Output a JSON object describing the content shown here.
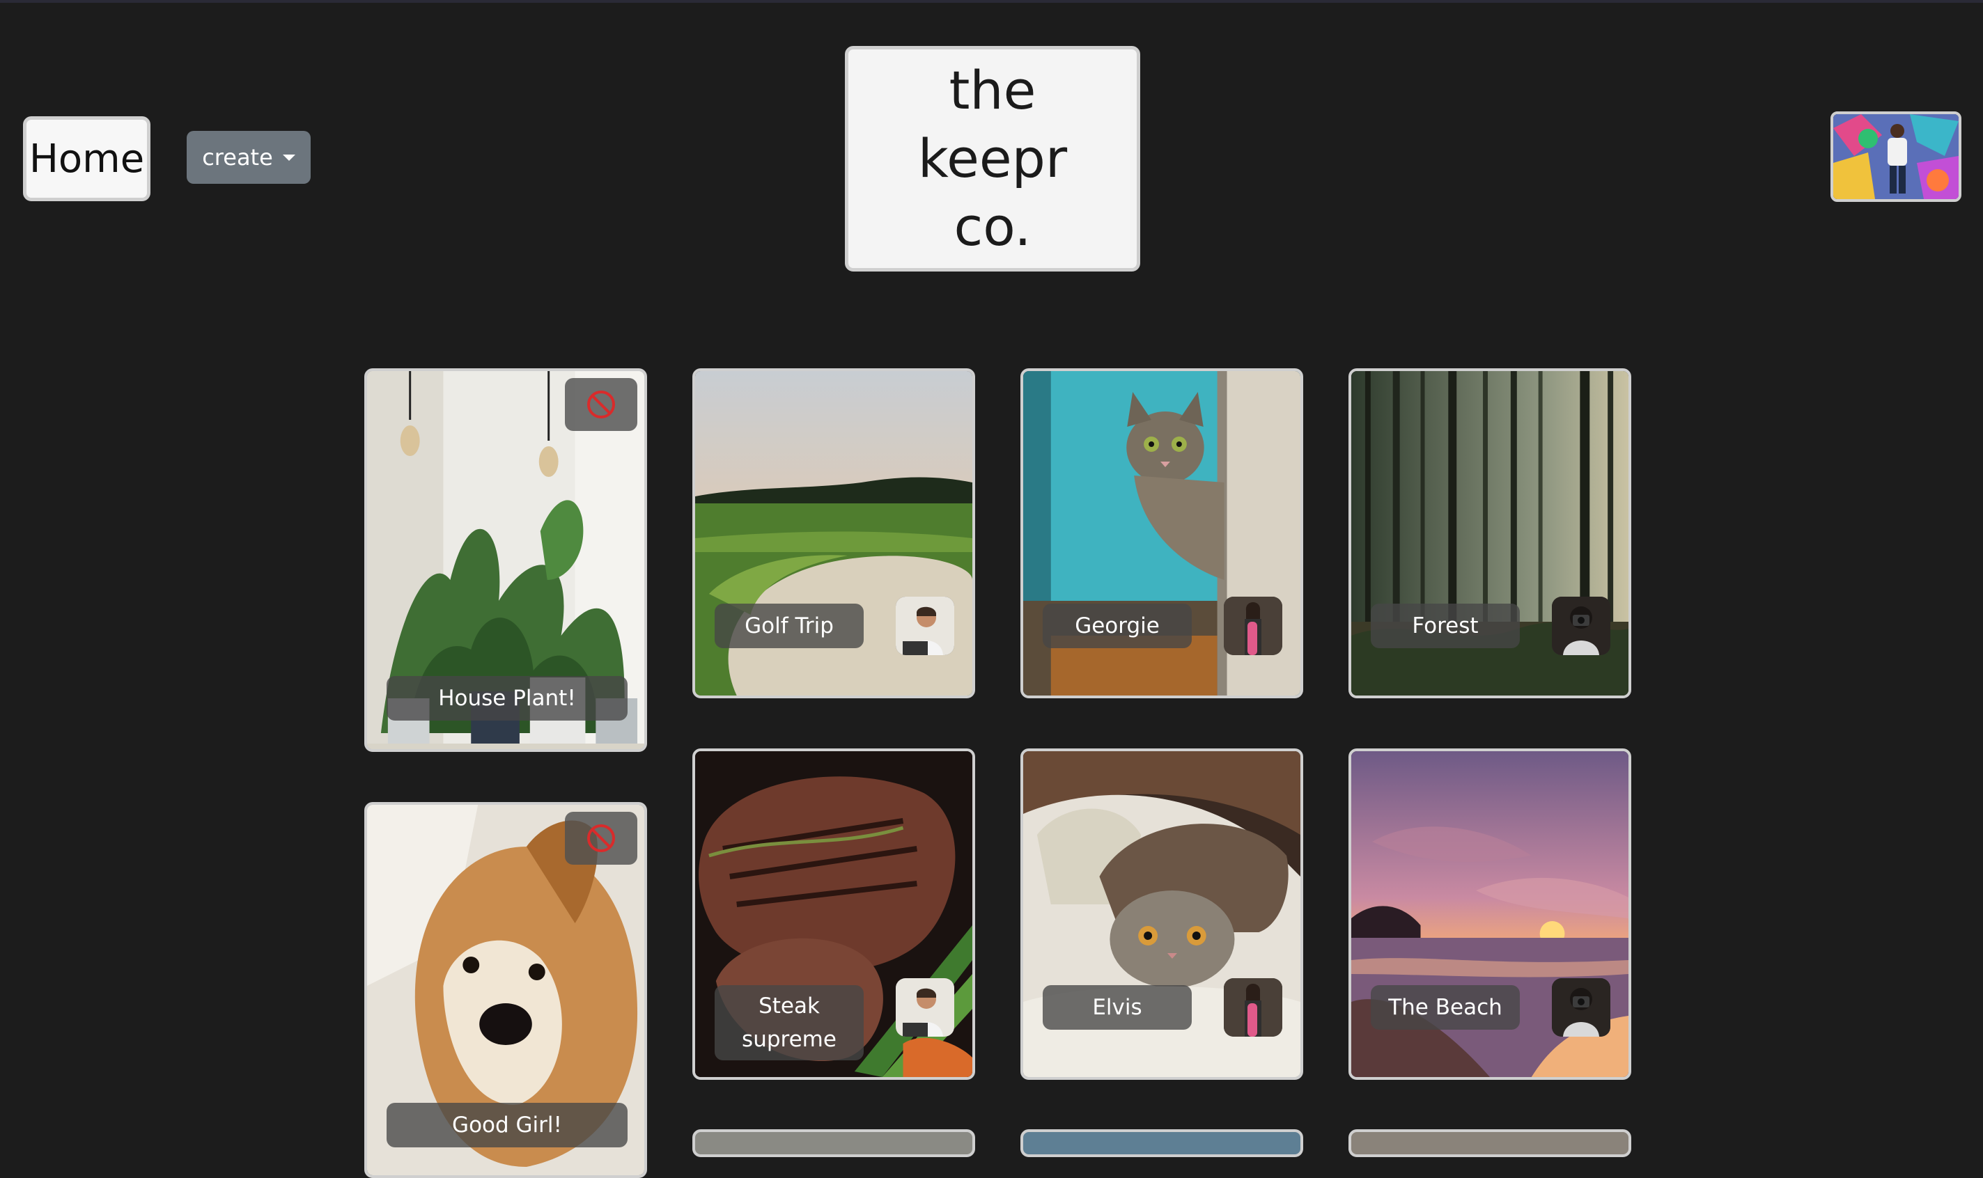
{
  "nav": {
    "home_label": "Home",
    "create_label": "create"
  },
  "brand": {
    "line1": "the keepr",
    "line2": "co."
  },
  "keeps": [
    {
      "name": "House Plant!",
      "removable": true
    },
    {
      "name": "Golf Trip",
      "removable": false
    },
    {
      "name": "Georgie",
      "removable": false
    },
    {
      "name": "Forest",
      "removable": false
    },
    {
      "name": "Good Girl!",
      "removable": true
    },
    {
      "name": "Steak supreme",
      "removable": false
    },
    {
      "name": "Elvis",
      "removable": false
    },
    {
      "name": "The Beach",
      "removable": false
    }
  ],
  "icons": {
    "remove": "ban-icon",
    "dropdown": "caret-down-icon"
  },
  "colors": {
    "background": "#1c1c1c",
    "create_button": "#6c757d",
    "remove_icon": "#d92b2b"
  }
}
